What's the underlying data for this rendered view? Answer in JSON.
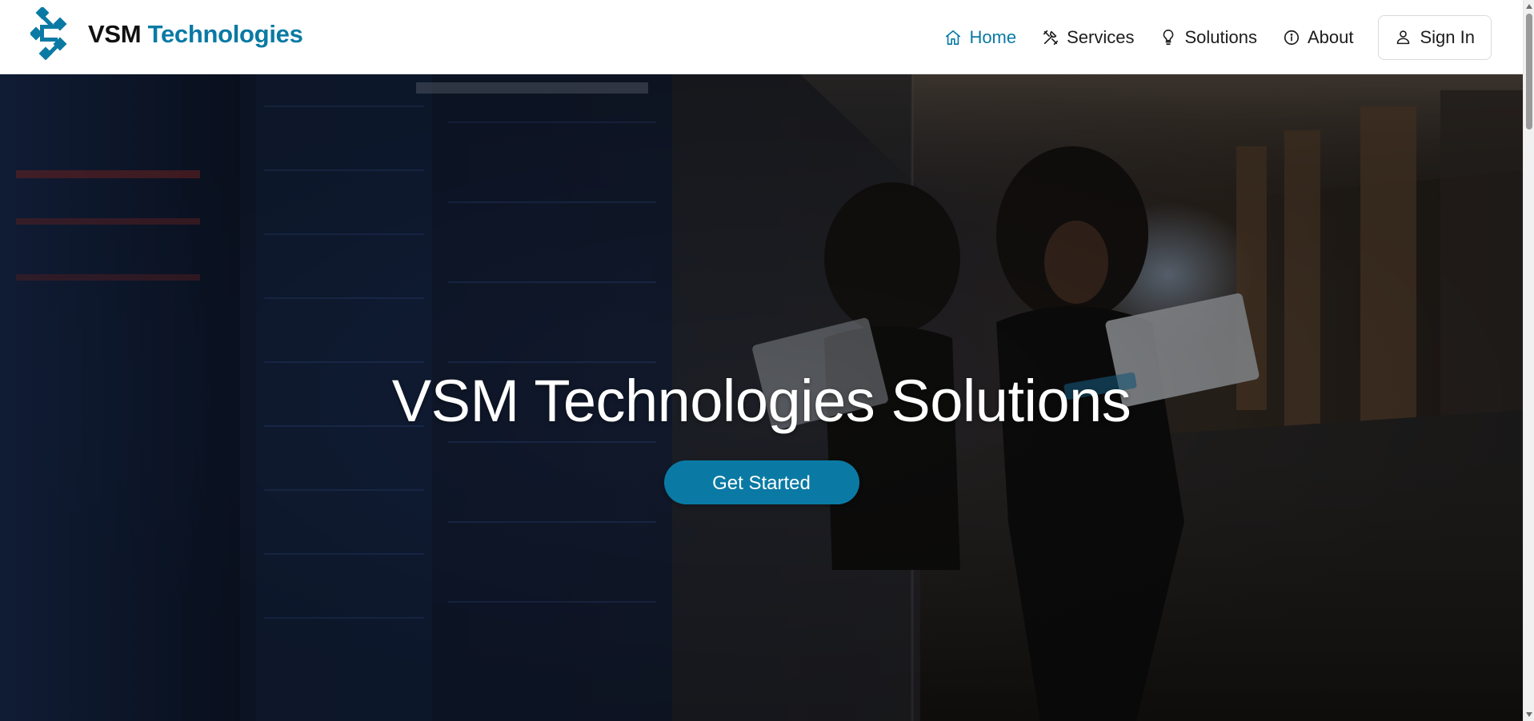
{
  "header": {
    "brand": {
      "name_first": "VSM",
      "name_second": "Technologies",
      "logo_icon": "vsm-logo-icon"
    },
    "nav": [
      {
        "label": "Home",
        "icon": "home-icon",
        "active": true
      },
      {
        "label": "Services",
        "icon": "tools-icon",
        "active": false
      },
      {
        "label": "Solutions",
        "icon": "lightbulb-icon",
        "active": false
      },
      {
        "label": "About",
        "icon": "info-icon",
        "active": false
      }
    ],
    "signin": {
      "label": "Sign In",
      "icon": "user-icon"
    }
  },
  "hero": {
    "title": "VSM Technologies Solutions",
    "cta_label": "Get Started",
    "background": "server-room-office-photo"
  },
  "colors": {
    "accent": "#0a7aa4",
    "text": "#1c1c1c",
    "hero_text": "#ffffff"
  }
}
